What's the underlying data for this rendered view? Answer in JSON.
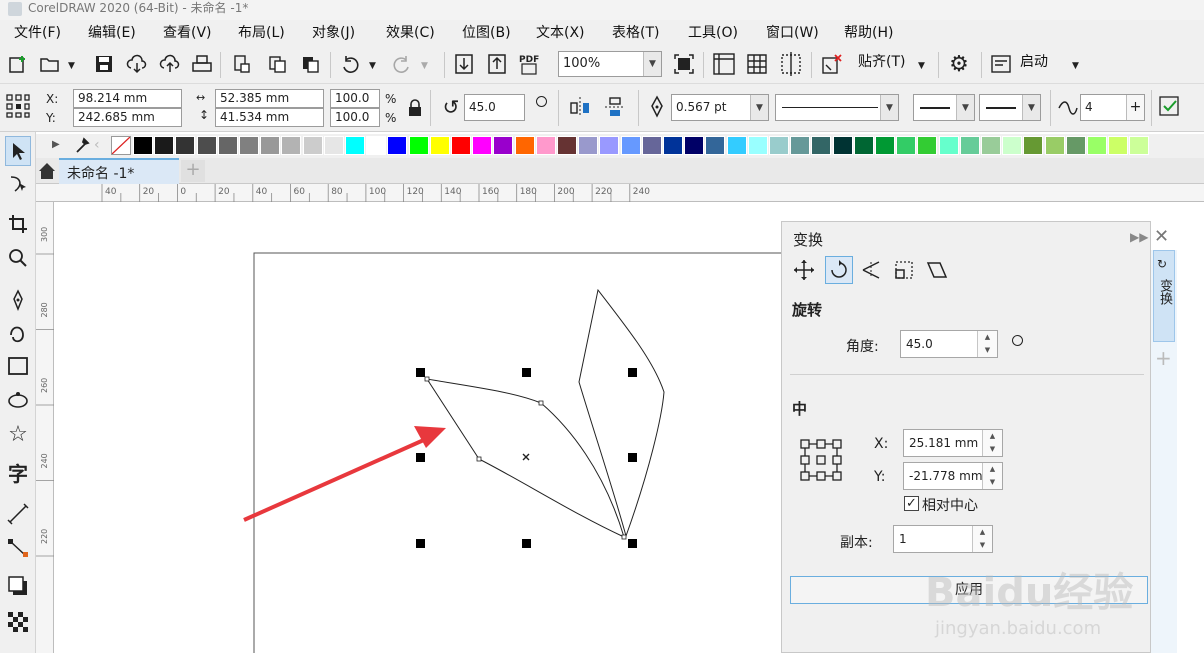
{
  "window": {
    "title": "CorelDRAW 2020 (64-Bit) - 未命名 -1*"
  },
  "menubar": {
    "items": [
      "文件(F)",
      "编辑(E)",
      "查看(V)",
      "布局(L)",
      "对象(J)",
      "效果(C)",
      "位图(B)",
      "文本(X)",
      "表格(T)",
      "工具(O)",
      "窗口(W)",
      "帮助(H)"
    ]
  },
  "toolbar": {
    "zoom_value": "100%",
    "snap_label": "贴齐(T)",
    "launch_label": "启动"
  },
  "propertybar": {
    "x_label": "X:",
    "x_value": "98.214 mm",
    "y_label": "Y:",
    "y_value": "242.685 mm",
    "width_value": "52.385 mm",
    "height_value": "41.534 mm",
    "scale_x": "100.0",
    "scale_y": "100.0",
    "percent_symbol": "%",
    "rotation": "45.0",
    "outline_width": "0.567 pt",
    "curve_nodes": "4"
  },
  "palette": {
    "colors": [
      "#000000",
      "#1a1a1a",
      "#333333",
      "#4d4d4d",
      "#666666",
      "#808080",
      "#999999",
      "#b3b3b3",
      "#cccccc",
      "#e6e6e6",
      "#00ffff",
      "#ffffff",
      "#0000ff",
      "#00ff00",
      "#ffff00",
      "#ff0000",
      "#ff00ff",
      "#9900cc",
      "#ff6600",
      "#ff99cc",
      "#663333",
      "#9999cc",
      "#9999ff",
      "#6699ff",
      "#666699",
      "#003399",
      "#000066",
      "#336699",
      "#33ccff",
      "#99ffff",
      "#99cccc",
      "#669999",
      "#336666",
      "#003333",
      "#006633",
      "#009933",
      "#33cc66",
      "#33cc33",
      "#66ffcc",
      "#66cc99",
      "#99cc99",
      "#ccffcc",
      "#669933",
      "#99cc66",
      "#669966",
      "#99ff66",
      "#ccff66",
      "#ccff99"
    ]
  },
  "document_tab": {
    "label": "未命名 -1*"
  },
  "rulers": {
    "h_ticks": [
      "40",
      "20",
      "0",
      "20",
      "40",
      "60",
      "80",
      "100",
      "120",
      "140",
      "160",
      "180",
      "200",
      "220",
      "240"
    ],
    "v_ticks": [
      "300",
      "280",
      "260",
      "240",
      "220"
    ]
  },
  "docker": {
    "title": "变换",
    "section_rotate": "旋转",
    "angle_label": "角度:",
    "angle_value": "45.0",
    "section_center": "中",
    "cx_label": "X:",
    "cx_value": "25.181 mm",
    "cy_label": "Y:",
    "cy_value": "-21.778 mm",
    "relative_center_label": "相对中心",
    "copies_label": "副本:",
    "copies_value": "1",
    "apply_label": "应用",
    "side_tab_label": "变换"
  },
  "watermark": {
    "text": "Baidu经验",
    "url": "jingyan.baidu.com"
  },
  "colors": {
    "arrow": "#e8383d",
    "accent_blue": "#6aaedf"
  }
}
